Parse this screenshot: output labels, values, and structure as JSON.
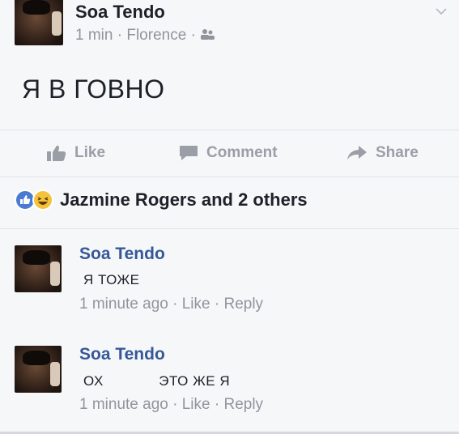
{
  "post": {
    "author": "Soa Tendo",
    "time": "1 min",
    "separator": "·",
    "location": "Florence",
    "text": "Я В ГОВНО"
  },
  "actions": {
    "like": "Like",
    "comment": "Comment",
    "share": "Share"
  },
  "reactions": {
    "summary": "Jazmine Rogers and 2 others"
  },
  "comments": [
    {
      "author": "Soa Tendo",
      "text": "Я ТОЖЕ",
      "meta": "1 minute ago · Like · Reply"
    },
    {
      "author": "Soa Tendo",
      "text_part1": "ОХ",
      "text_part2": "ЭТО ЖЕ Я",
      "meta": "1 minute ago · Like · Reply"
    }
  ],
  "icons": [
    "chevron-down-icon",
    "friends-icon",
    "like-icon",
    "comment-icon",
    "share-icon",
    "like-reaction-icon",
    "haha-reaction-icon"
  ],
  "colors": {
    "name_link": "#365899",
    "meta_gray": "#90949c",
    "like_blue": "#4a7bd3",
    "haha_yellow": "#f5c33b"
  }
}
